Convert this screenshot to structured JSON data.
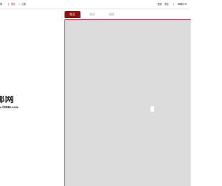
{
  "topbar": {
    "left": [
      "网",
      "首页",
      "注册"
    ],
    "right": [
      "登录",
      "退出",
      "邮箱网 ID"
    ]
  },
  "logo": {
    "title": "邮网",
    "domain_prefix": "w.",
    "domain_highlight": "if",
    "domain_suffix": "1988.com"
  },
  "tabs": [
    {
      "label": "购买",
      "active": true
    },
    {
      "label": "发买",
      "active": false
    },
    {
      "label": "成交",
      "active": false
    }
  ],
  "colors": {
    "accent": "#8f1111",
    "panel": "#dcdcdc"
  }
}
